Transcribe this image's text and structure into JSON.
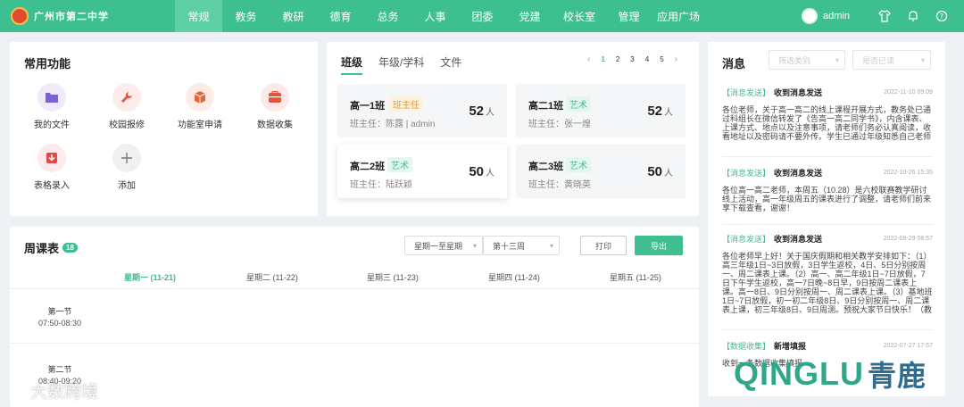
{
  "school_name": "广州市第二中学",
  "nav": [
    "常规",
    "教务",
    "教研",
    "德育",
    "总务",
    "人事",
    "团委",
    "党建",
    "校长室",
    "管理",
    "应用广场"
  ],
  "user": "admin",
  "common": {
    "title": "常用功能",
    "items": [
      {
        "label": "我的文件",
        "icon": "folder-icon",
        "color": "#7b63d6",
        "bg": "#efebfb"
      },
      {
        "label": "校园报修",
        "icon": "wrench-icon",
        "color": "#e2563a",
        "bg": "#fdecea"
      },
      {
        "label": "功能室申请",
        "icon": "cube-icon",
        "color": "#e5663b",
        "bg": "#fdece5"
      },
      {
        "label": "数据收集",
        "icon": "box-icon",
        "color": "#e5533a",
        "bg": "#fdeae8"
      },
      {
        "label": "表格录入",
        "icon": "download-icon",
        "color": "#e64846",
        "bg": "#fdeaea"
      },
      {
        "label": "添加",
        "icon": "plus-icon",
        "color": "#777777",
        "bg": "#f0f0f0"
      }
    ]
  },
  "classes": {
    "tabs": [
      "班级",
      "年级/学科",
      "文件"
    ],
    "pages": [
      "1",
      "2",
      "3",
      "4",
      "5"
    ],
    "list": [
      {
        "name": "高一1班",
        "tag": "班主任",
        "tag_type": "head",
        "teacher": "班主任：陈露 | admin",
        "count": "52",
        "unit": "人"
      },
      {
        "name": "高二1班",
        "tag": "艺术",
        "tag_type": "art",
        "teacher": "班主任：张一煌",
        "count": "52",
        "unit": "人"
      },
      {
        "name": "高二2班",
        "tag": "艺术",
        "tag_type": "art",
        "teacher": "班主任：陆跃颖",
        "count": "50",
        "unit": "人"
      },
      {
        "name": "高二3班",
        "tag": "艺术",
        "tag_type": "art",
        "teacher": "班主任：黄晓英",
        "count": "50",
        "unit": "人"
      }
    ]
  },
  "timetable": {
    "title": "周课表",
    "badge": "18",
    "range_select": "星期一至星期",
    "week_select": "第十三周",
    "print": "打印",
    "export": "导出",
    "days": [
      "星期一 (11-21)",
      "星期二 (11-22)",
      "星期三 (11-23)",
      "星期四 (11-24)",
      "星期五 (11-25)"
    ],
    "periods": [
      {
        "name": "第一节",
        "time": "07:50-08:30"
      },
      {
        "name": "第二节",
        "time": "08:40-09:20"
      }
    ]
  },
  "messages": {
    "title": "消息",
    "filter1": "筛选类别",
    "filter2": "是否已读",
    "items": [
      {
        "tag": "【消息发送】",
        "title": "收到消息发送",
        "date": "2022-11-10 09:09",
        "body": "各位老师，关于高一高二的线上课程开展方式，教务处已通过科组长在微信转发了《告高一高二同学书》，内含课表、上课方式、地点以及注意事项，请老师们务必认真阅读，收看地址以及密码请不要外传。学生已通过年级知悉自己老师的地址。"
      },
      {
        "tag": "【消息发送】",
        "title": "收到消息发送",
        "date": "2022-10-26 15:35",
        "body": "各位高一高二老师，本周五（10.28）是六校联赛教学研讨线上活动，高一年级周五的课表进行了调整，请老师们前来享下载查看，谢谢！"
      },
      {
        "tag": "【消息发送】",
        "title": "收到消息发送",
        "date": "2022-09-29 08:57",
        "body": "各位老师早上好！关于国庆假期和相关教学安排如下：（1）高三年级1日~3日放假，3日学生返校，4日、5日分别按周一、周二课表上课。（2）高一、高二年级1日~7日放假，7日下午学生返校，高一7日晚~8日早，9日按周二课表上课。高一8日、9日分别按周一、周二课表上课。（3）基地班1日~7日放假，初一初二年级8日、9日分别按周一、周二课表上课，初三年级8日、9日周测。预祝大家节日快乐！（教务处）"
      },
      {
        "tag": "【数据收集】",
        "title": "新增填报",
        "date": "2022-07-27 17:57",
        "body": "收到一条数据收集填报"
      }
    ]
  },
  "watermarks": {
    "left": "大数跨境",
    "right_latin": "QINGLU",
    "right_cn": "青鹿"
  }
}
